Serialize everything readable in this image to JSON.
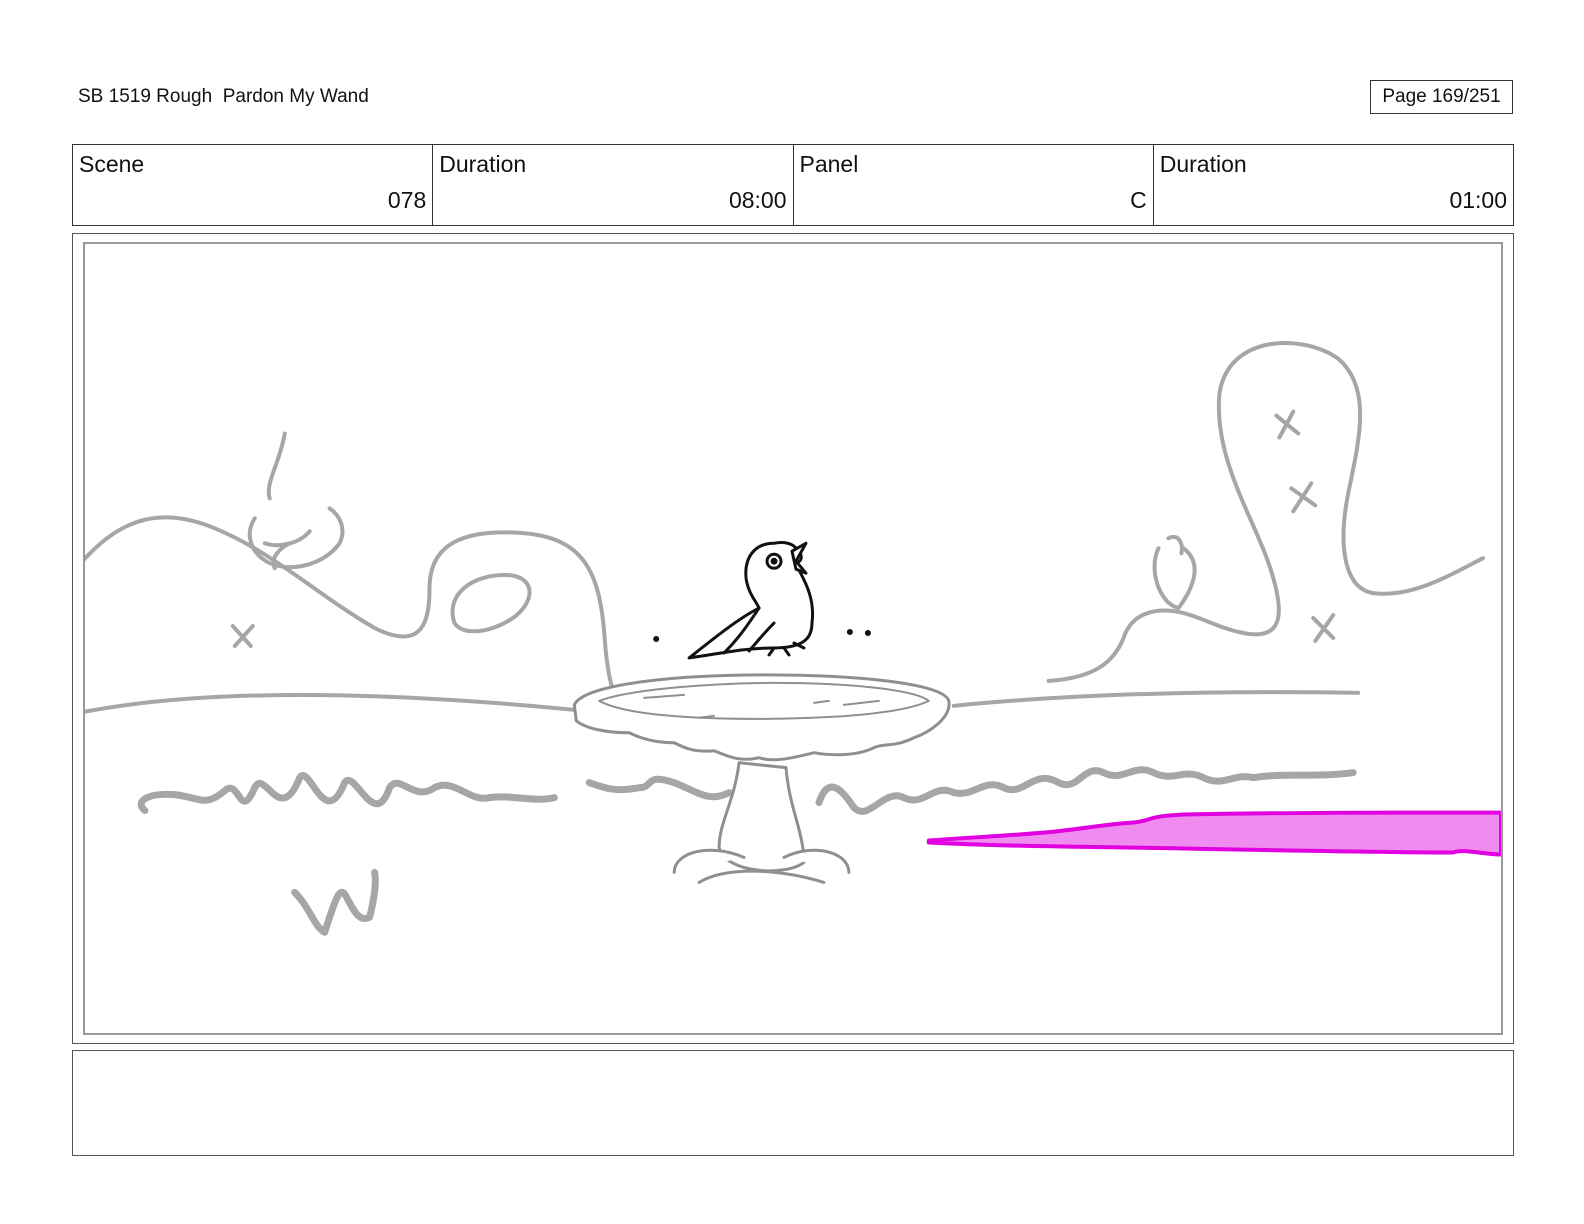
{
  "header": {
    "title": "SB 1519 Rough  Pardon My Wand",
    "page": "Page 169/251"
  },
  "info": {
    "scene_label": "Scene",
    "scene_value": "078",
    "scene_duration_label": "Duration",
    "scene_duration_value": "08:00",
    "panel_label": "Panel",
    "panel_value": "C",
    "panel_duration_label": "Duration",
    "panel_duration_value": "01:00"
  },
  "colors": {
    "sketch_gray": "#a6a6a6",
    "ink_black": "#111111",
    "magic_magenta": "#e000e0",
    "magic_fill": "#f08cf0"
  },
  "notes": {
    "text": ""
  }
}
